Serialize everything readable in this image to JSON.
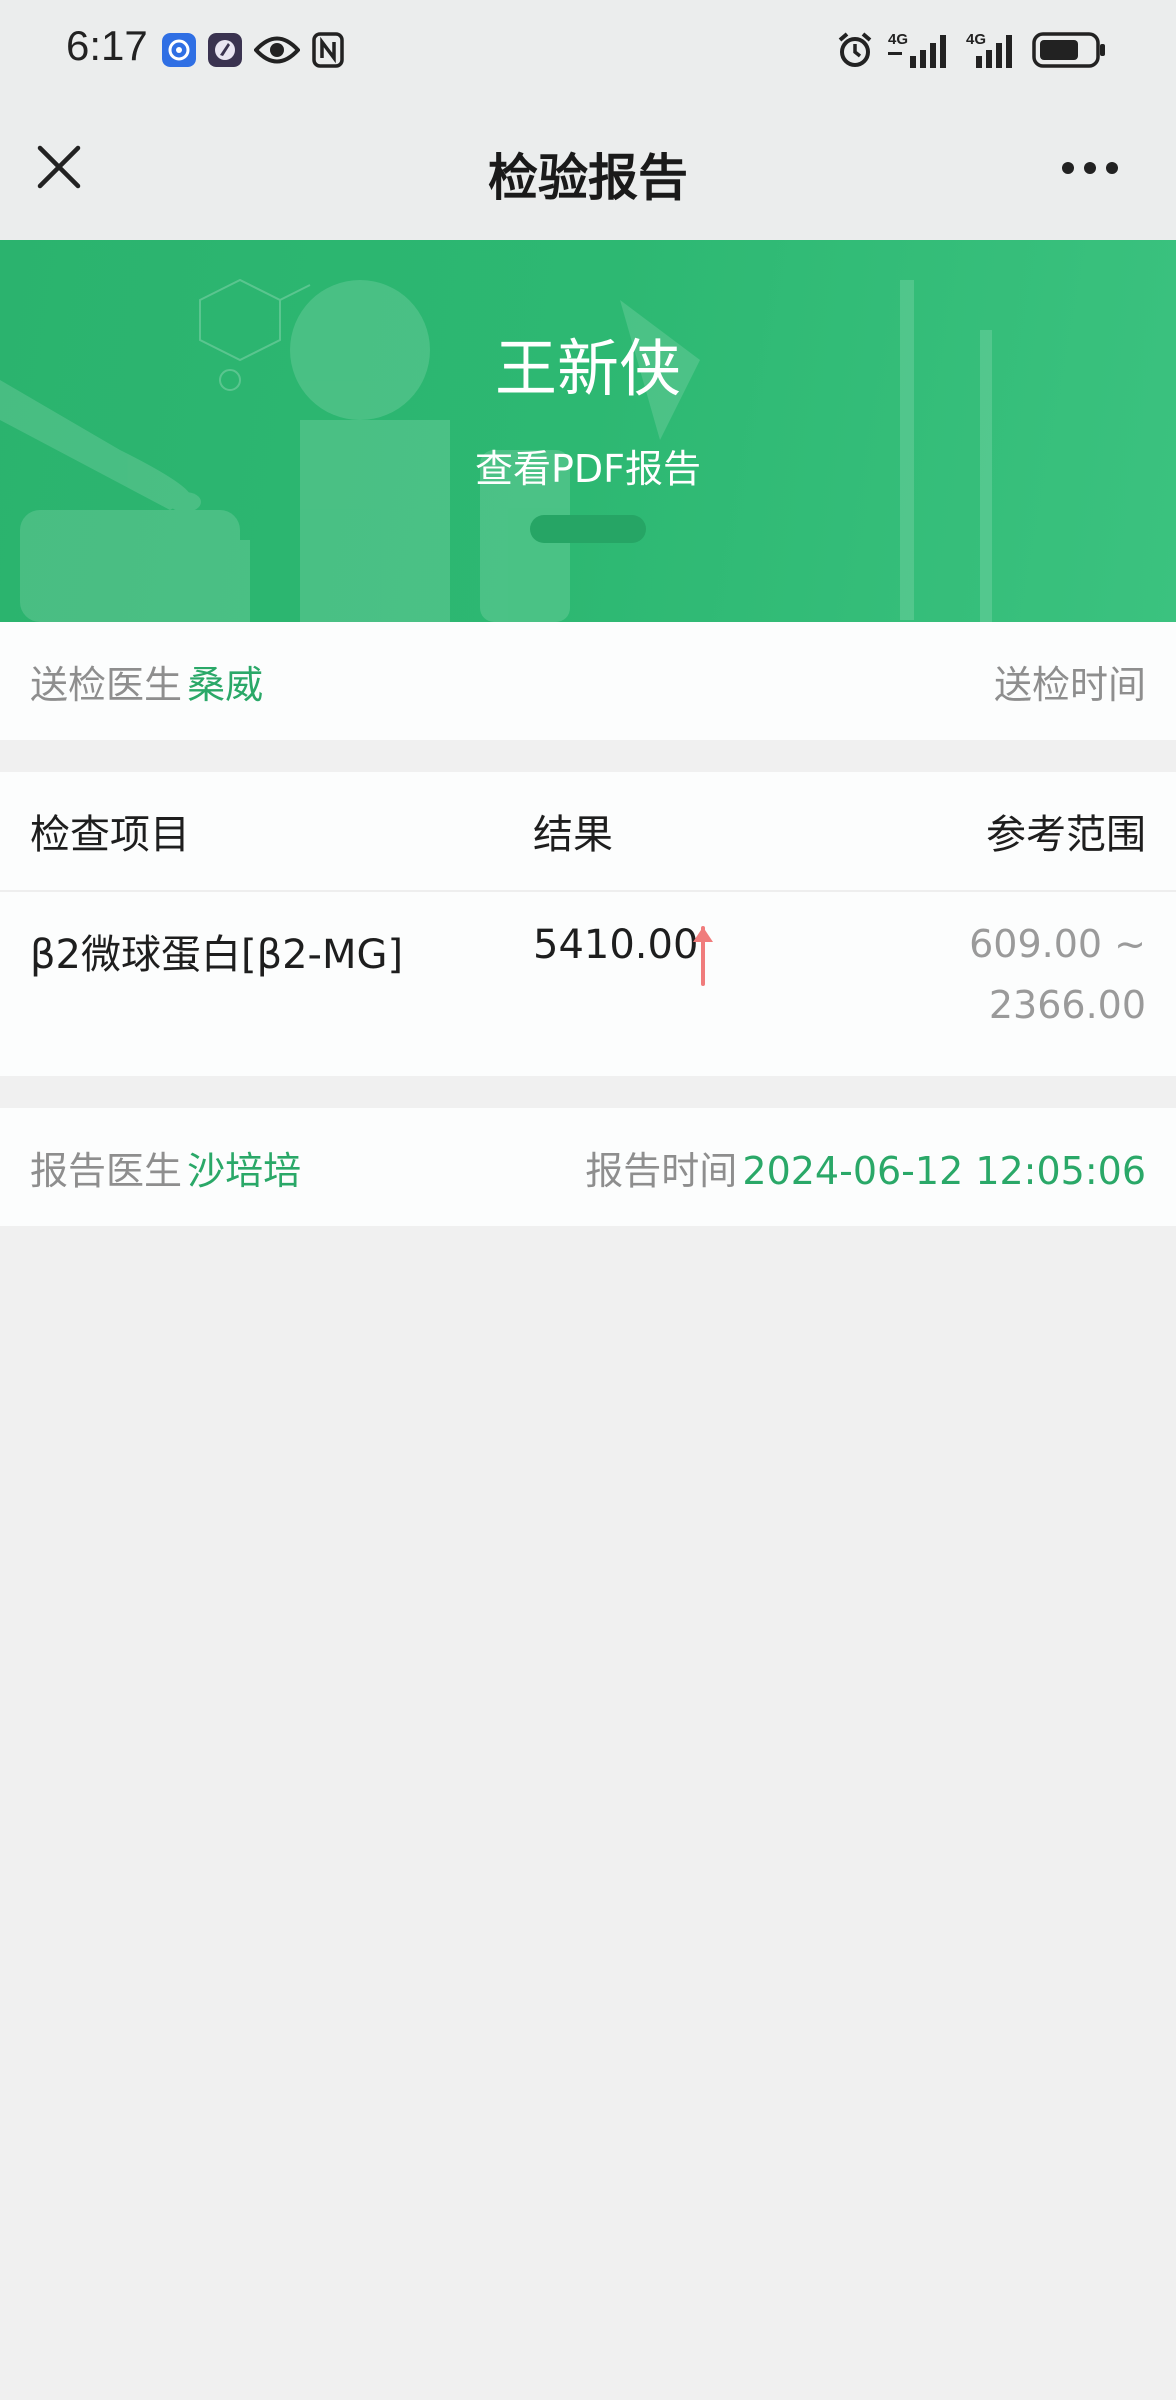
{
  "status_bar": {
    "time": "6:17",
    "left_icons": [
      "app-badge-icon",
      "app-badge-icon-2",
      "eye-icon",
      "nfc-icon"
    ],
    "right_icons": [
      "alarm-icon",
      "signal-4g-icon",
      "signal-4g-icon-2",
      "battery-icon"
    ],
    "network_label_1": "4G",
    "network_label_2": "4G"
  },
  "nav": {
    "title": "检验报告",
    "close_icon": "close-icon",
    "more_icon": "more-icon"
  },
  "banner": {
    "patient_name": "王新侠",
    "pdf_link": "查看PDF报告",
    "background_color": "#2db872"
  },
  "sender": {
    "doctor_label": "送检医生",
    "doctor_name": "桑威",
    "time_label": "送检时间"
  },
  "table": {
    "headers": {
      "item": "检查项目",
      "result": "结果",
      "range": "参考范围"
    },
    "rows": [
      {
        "item": "β2微球蛋白[β2-MG]",
        "result": "5410.00",
        "flag": "up-arrow-icon",
        "range_line1": "609.00 ~",
        "range_line2": "2366.00"
      }
    ]
  },
  "report": {
    "doctor_label": "报告医生",
    "doctor_name": "沙培培",
    "time_label": "报告时间",
    "time_value": "2024-06-12 12:05:06"
  },
  "colors": {
    "accent_green": "#2aa868",
    "alert_red": "#f07c7c",
    "muted_text": "#8e8e8e"
  }
}
